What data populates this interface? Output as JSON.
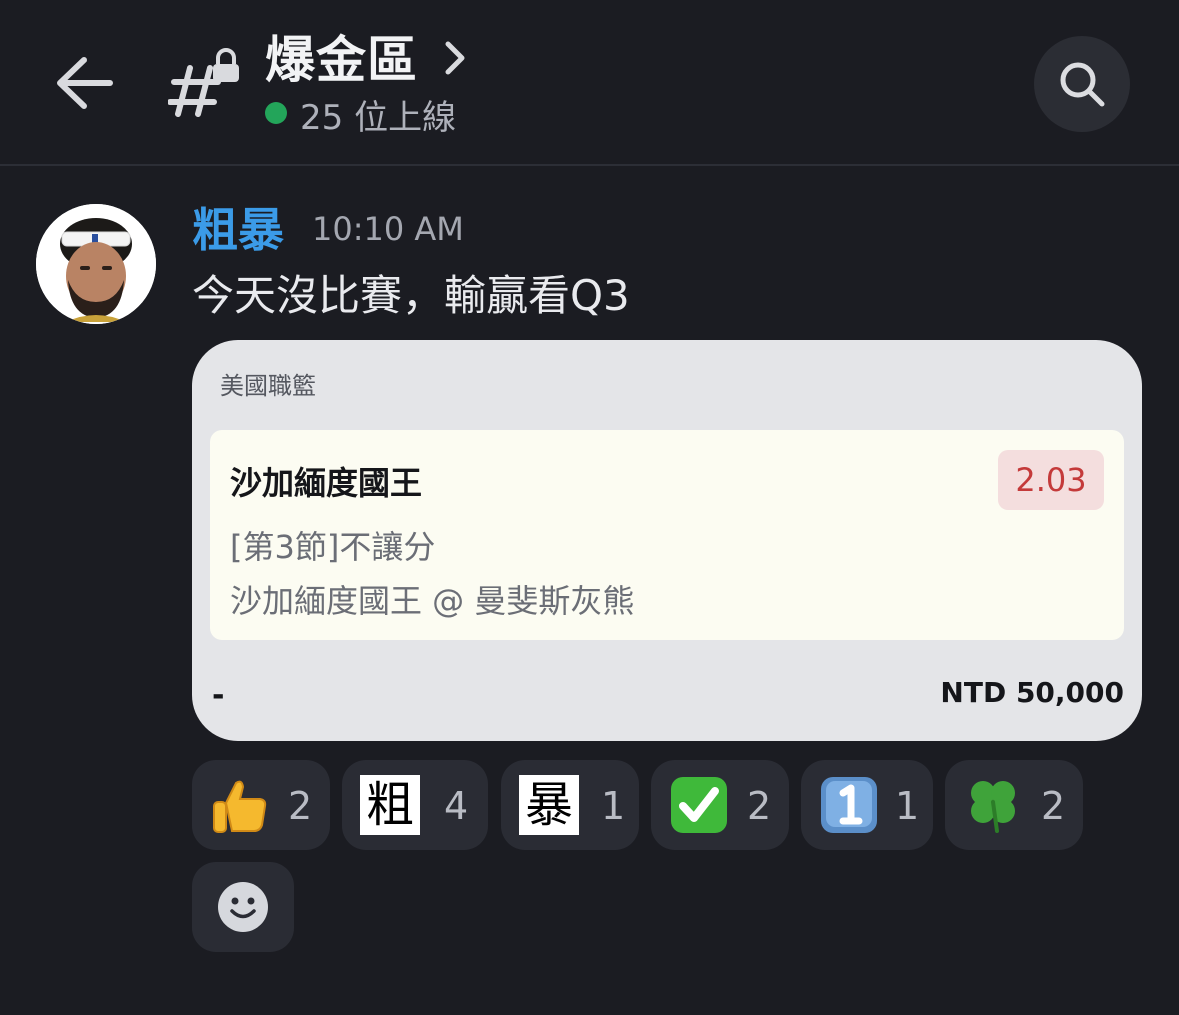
{
  "header": {
    "channel_name": "爆金區",
    "online_count_text": "25 位上線"
  },
  "message": {
    "author": "粗暴",
    "timestamp": "10:10 AM",
    "text": "今天沒比賽，輸贏看Q3"
  },
  "bet_card": {
    "league": "美國職籃",
    "team": "沙加緬度國王",
    "odds": "2.03",
    "bet_type": "[第3節]不讓分",
    "matchup": "沙加緬度國王 @ 曼斐斯灰熊",
    "status": "-",
    "amount": "NTD 50,000"
  },
  "reactions": [
    {
      "emoji": "thumbs-up",
      "char": "",
      "count": "2"
    },
    {
      "emoji": "custom-char",
      "char": "粗",
      "count": "4"
    },
    {
      "emoji": "custom-char",
      "char": "暴",
      "count": "1"
    },
    {
      "emoji": "check-mark",
      "char": "",
      "count": "2"
    },
    {
      "emoji": "keycap-one",
      "char": "",
      "count": "1"
    },
    {
      "emoji": "four-leaf-clover",
      "char": "",
      "count": "2"
    }
  ],
  "colors": {
    "background": "#1b1c22",
    "author": "#3b9be8",
    "online": "#23a55a",
    "odds_text": "#c43a3a"
  }
}
